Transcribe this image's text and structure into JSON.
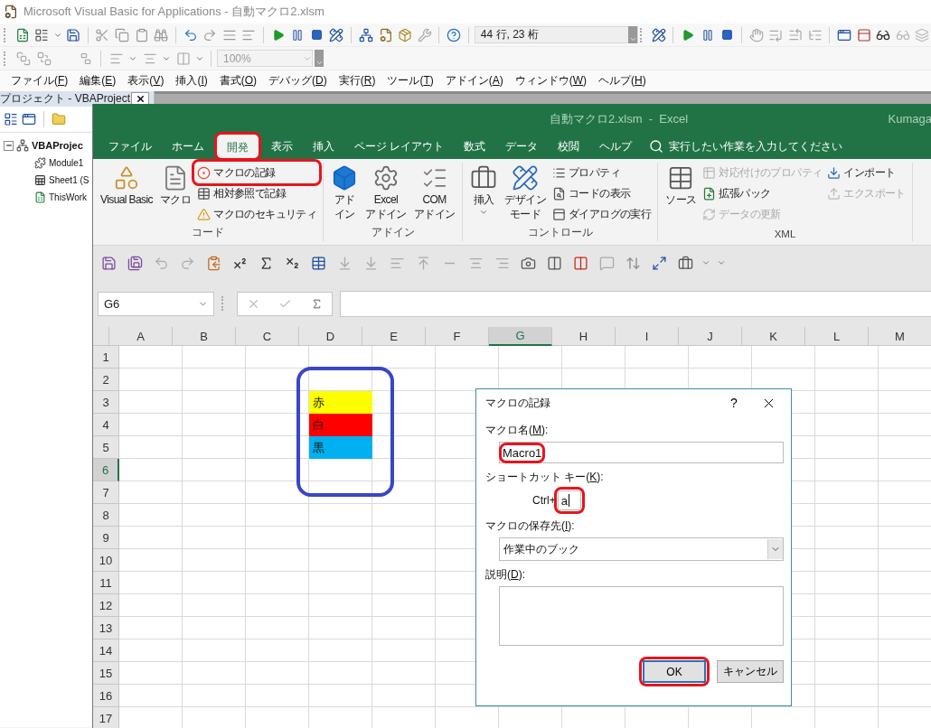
{
  "vba": {
    "title": "Microsoft Visual Basic for Applications - 自動マクロ2.xlsm",
    "position": "44 行, 23 桁",
    "zoom": "100%",
    "menu": [
      {
        "before": "ファイル(",
        "key": "F",
        "after": ")"
      },
      {
        "before": "編集(",
        "key": "E",
        "after": ")"
      },
      {
        "before": "表示(",
        "key": "V",
        "after": ")"
      },
      {
        "before": "挿入(",
        "key": "I",
        "after": ")"
      },
      {
        "before": "書式(",
        "key": "O",
        "after": ")"
      },
      {
        "before": "デバッグ(",
        "key": "D",
        "after": ")"
      },
      {
        "before": "実行(",
        "key": "R",
        "after": ")"
      },
      {
        "before": "ツール(",
        "key": "T",
        "after": ")"
      },
      {
        "before": "アドイン(",
        "key": "A",
        "after": ")"
      },
      {
        "before": "ウィンドウ(",
        "key": "W",
        "after": ")"
      },
      {
        "before": "ヘルプ(",
        "key": "H",
        "after": ")"
      }
    ],
    "project": {
      "title": "プロジェクト - VBAProject",
      "tree": [
        {
          "label": "VBAProjec",
          "expanded": true,
          "children": [
            {
              "label": "Module1",
              "kind": "module"
            },
            {
              "label": "Sheet1 (S",
              "kind": "sheet"
            },
            {
              "label": "ThisWork",
              "kind": "workbook"
            }
          ]
        }
      ]
    }
  },
  "excel": {
    "title": "自動マクロ2.xlsm  -  Excel",
    "user": "Kumaga",
    "tabs": [
      {
        "label": "ファイル",
        "selected": false,
        "circled": false
      },
      {
        "label": "ホーム",
        "selected": false,
        "circled": false
      },
      {
        "label": "開発",
        "selected": true,
        "circled": true
      },
      {
        "label": "表示",
        "selected": false,
        "circled": false
      },
      {
        "label": "挿入",
        "selected": false,
        "circled": false
      },
      {
        "label": "ページ レイアウト",
        "selected": false,
        "circled": false
      },
      {
        "label": "数式",
        "selected": false,
        "circled": false
      },
      {
        "label": "データ",
        "selected": false,
        "circled": false
      },
      {
        "label": "校閲",
        "selected": false,
        "circled": false
      },
      {
        "label": "ヘルプ",
        "selected": false,
        "circled": false
      }
    ],
    "search": {
      "placeholder": "実行したい作業を入力してください"
    },
    "ribbon": [
      {
        "label": "コード",
        "large": [
          {
            "lines": [
              "Visual Basic"
            ],
            "dropdown": false
          },
          {
            "lines": [
              "マクロ"
            ],
            "dropdown": false
          }
        ],
        "small": [
          [
            {
              "label": "マクロの記録",
              "disabled": false,
              "circled": true
            },
            {
              "label": "相対参照で記録",
              "disabled": false,
              "circled": false
            },
            {
              "label": "マクロのセキュリティ",
              "disabled": false,
              "circled": false
            }
          ]
        ]
      },
      {
        "label": "アドイン",
        "large": [
          {
            "lines": [
              "アド",
              "イン"
            ],
            "dropdown": false
          },
          {
            "lines": [
              "Excel",
              "アドイン"
            ],
            "dropdown": false
          },
          {
            "lines": [
              "COM",
              "アドイン"
            ],
            "dropdown": false
          }
        ]
      },
      {
        "label": "コントロール",
        "large": [
          {
            "lines": [
              "挿入"
            ],
            "dropdown": true
          },
          {
            "lines": [
              "デザイン",
              "モード"
            ],
            "dropdown": false
          }
        ],
        "small": [
          [
            {
              "label": "プロパティ",
              "disabled": false,
              "circled": false
            },
            {
              "label": "コードの表示",
              "disabled": false,
              "circled": false
            },
            {
              "label": "ダイアログの実行",
              "disabled": false,
              "circled": false
            }
          ]
        ]
      },
      {
        "label": "XML",
        "large": [
          {
            "lines": [
              "ソース"
            ],
            "dropdown": false
          }
        ],
        "small": [
          [
            {
              "label": "対応付けのプロパティ",
              "disabled": true,
              "circled": false
            },
            {
              "label": "拡張パック",
              "disabled": false,
              "circled": false
            },
            {
              "label": "データの更新",
              "disabled": true,
              "circled": false
            }
          ],
          [
            {
              "label": "インポート",
              "disabled": false,
              "circled": false
            },
            {
              "label": "エクスポート",
              "disabled": true,
              "circled": false
            }
          ]
        ]
      }
    ],
    "name_box": "G6",
    "grid": {
      "columns": [
        {
          "label": "A",
          "selected": false
        },
        {
          "label": "B",
          "selected": false
        },
        {
          "label": "C",
          "selected": false
        },
        {
          "label": "D",
          "selected": false
        },
        {
          "label": "E",
          "selected": false
        },
        {
          "label": "F",
          "selected": false
        },
        {
          "label": "G",
          "selected": true
        },
        {
          "label": "H",
          "selected": false
        },
        {
          "label": "I",
          "selected": false
        },
        {
          "label": "J",
          "selected": false
        },
        {
          "label": "K",
          "selected": false
        },
        {
          "label": "L",
          "selected": false
        },
        {
          "label": "M",
          "selected": false
        }
      ],
      "rows": [
        {
          "label": "1",
          "selected": false
        },
        {
          "label": "2",
          "selected": false
        },
        {
          "label": "3",
          "selected": false,
          "cells": [
            null,
            null,
            null,
            {
              "text": "赤",
              "color": "#ffff00"
            }
          ]
        },
        {
          "label": "4",
          "selected": false,
          "cells": [
            null,
            null,
            null,
            {
              "text": "白",
              "color": "#ff0000"
            }
          ]
        },
        {
          "label": "5",
          "selected": false,
          "cells": [
            null,
            null,
            null,
            {
              "text": "黒",
              "color": "#00b0f0"
            }
          ]
        },
        {
          "label": "6",
          "selected": true
        },
        {
          "label": "7",
          "selected": false
        },
        {
          "label": "8",
          "selected": false
        },
        {
          "label": "9",
          "selected": false
        },
        {
          "label": "10",
          "selected": false
        },
        {
          "label": "11",
          "selected": false
        },
        {
          "label": "12",
          "selected": false
        },
        {
          "label": "13",
          "selected": false
        },
        {
          "label": "14",
          "selected": false
        },
        {
          "label": "15",
          "selected": false
        },
        {
          "label": "16",
          "selected": false
        },
        {
          "label": "17",
          "selected": false
        }
      ]
    },
    "dialog": {
      "title": "マクロの記録",
      "help": "?",
      "fields": [
        {
          "kind": "text",
          "label": {
            "before": "マクロ名(",
            "key": "M",
            "after": "):"
          },
          "value": "Macro1",
          "circled": true,
          "focused": false
        },
        {
          "kind": "shortcut",
          "label": {
            "before": "ショートカット キー(",
            "key": "K",
            "after": "):"
          },
          "prefix": "Ctrl+",
          "value": "a",
          "circled": true,
          "focused": true
        },
        {
          "kind": "select",
          "label": {
            "before": "マクロの保存先(",
            "key": "I",
            "after": "):"
          },
          "value": "作業中のブック",
          "circled": false,
          "focused": false
        },
        {
          "kind": "textarea",
          "label": {
            "before": "説明(",
            "key": "D",
            "after": "):"
          },
          "circled": false,
          "focused": false
        }
      ],
      "buttons": [
        {
          "label": "OK",
          "default": true,
          "circled": true
        },
        {
          "label": "キャンセル",
          "default": false,
          "circled": false
        }
      ]
    }
  }
}
